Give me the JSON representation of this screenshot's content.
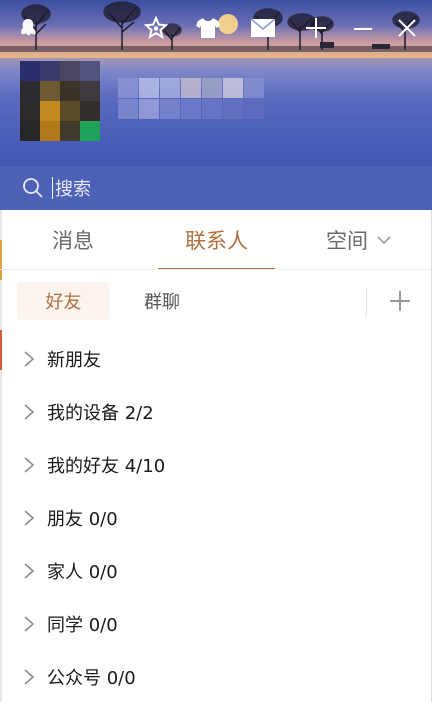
{
  "search": {
    "placeholder": "搜索"
  },
  "topbar": {
    "icons": [
      "app-logo-icon",
      "star-icon",
      "tshirt-icon",
      "mail-icon",
      "plus-icon",
      "minimize-icon",
      "close-icon"
    ]
  },
  "main_tabs": [
    {
      "label": "消息",
      "active": false
    },
    {
      "label": "联系人",
      "active": true
    },
    {
      "label": "空间",
      "active": false,
      "has_dropdown": true
    }
  ],
  "sub_tabs": [
    {
      "label": "好友",
      "active": true
    },
    {
      "label": "群聊",
      "active": false
    }
  ],
  "groups": [
    {
      "label": "新朋友"
    },
    {
      "label": "我的设备 2/2"
    },
    {
      "label": "我的好友 4/10"
    },
    {
      "label": "朋友 0/0"
    },
    {
      "label": "家人 0/0"
    },
    {
      "label": "同学 0/0"
    },
    {
      "label": "公众号 0/0"
    }
  ],
  "colors": {
    "accent": "#b1703c",
    "header_blue": "#4357b2"
  }
}
